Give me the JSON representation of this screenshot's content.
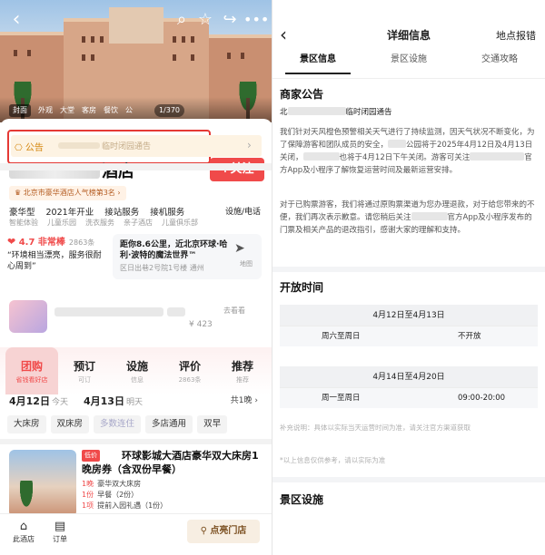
{
  "left": {
    "hero_tabs": [
      "封面",
      "外观",
      "大堂",
      "客房",
      "餐饮",
      "公"
    ],
    "pager": "1/370",
    "notice": {
      "tag": "公告",
      "text": "临时闭园通告"
    },
    "hotel": {
      "name_suffix": "酒店",
      "follow": "+关注",
      "rank": "北京市豪华酒店人气榜第3名"
    },
    "facts": [
      "豪华型",
      "2021年开业",
      "接站服务",
      "接机服务"
    ],
    "facts_link": "设施/电话",
    "subfacts": [
      "智能体验",
      "儿童乐园",
      "洗衣服务",
      "亲子酒店",
      "儿童俱乐部"
    ],
    "rating": {
      "score": "4.7 非常棒",
      "count": "2863条",
      "quote": "“环境相当漂亮，服务很耐心周到”"
    },
    "map": {
      "title": "距你8.6公里，近北京环球·哈利·波特的魔法世界™",
      "sub": "区日出巷2号院1号楼",
      "place": "通州",
      "label": "地图"
    },
    "promo": {
      "price": "¥ 423",
      "more": "去看看"
    },
    "tabs": [
      {
        "label": "团购",
        "sub": "省钱看好店"
      },
      {
        "label": "预订",
        "sub": "可订"
      },
      {
        "label": "设施",
        "sub": "信息"
      },
      {
        "label": "评价",
        "sub": "2863条"
      },
      {
        "label": "推荐",
        "sub": "推荐"
      }
    ],
    "dates": {
      "d1": "4月12日",
      "w1": "今天",
      "d2": "4月13日",
      "w2": "明天",
      "nights": "共1晚"
    },
    "chips": [
      "大床房",
      "双床房",
      "多数连住",
      "多店通用",
      "双早"
    ],
    "deal": {
      "badge": "低价",
      "title": "环球影城大酒店豪华双大床房1晚房券（含双份早餐）",
      "items": [
        {
          "k": "1晚",
          "v": "豪华双大床房"
        },
        {
          "k": "1份",
          "v": "早餐（2份）"
        },
        {
          "k": "1项",
          "v": "提前入园礼遇（1份）"
        }
      ]
    },
    "bottom": {
      "shop": "此酒店",
      "order": "订单",
      "visit": "点亮门店"
    }
  },
  "right": {
    "title": "详细信息",
    "report": "地点报错",
    "tabs": [
      "景区信息",
      "景区设施",
      "交通攻略"
    ],
    "notice": {
      "heading": "商家公告",
      "title_prefix": "北",
      "title_suffix": "临时闭园通告",
      "para1": "我们针对天风橙色预警相关天气进行了持续监测，因天气状况不断变化，为了保障游客和团队成员的安全，",
      "para1b": "公园将于2025年4月12日及4月13日关闭，",
      "para1c": "也将于4月12日下午关闭。游客可关注",
      "para1d": "官方App及小程序了解恢复运营时间及最新运营安排。",
      "para2": "对于已购票游客，我们将通过原购票渠道为您办理退款，对于给您带来的不便，我们再次表示歉意。请您稍后关注",
      "para2b": "官方App及小程序发布的门票及相关产品的退改指引，感谢大家的理解和支持。"
    },
    "hours": {
      "heading": "开放时间",
      "blocks": [
        {
          "range": "4月12日至4月13日",
          "days": "周六至周日",
          "time": "不开放"
        },
        {
          "range": "4月14日至4月20日",
          "days": "周一至周日",
          "time": "09:00-20:00"
        }
      ],
      "note1": "补充说明：具体以实际当天运营时间为准，请关注官方渠道获取",
      "note2": "*以上信息仅供参考，请以实际为准"
    },
    "facilities_heading": "景区设施"
  }
}
